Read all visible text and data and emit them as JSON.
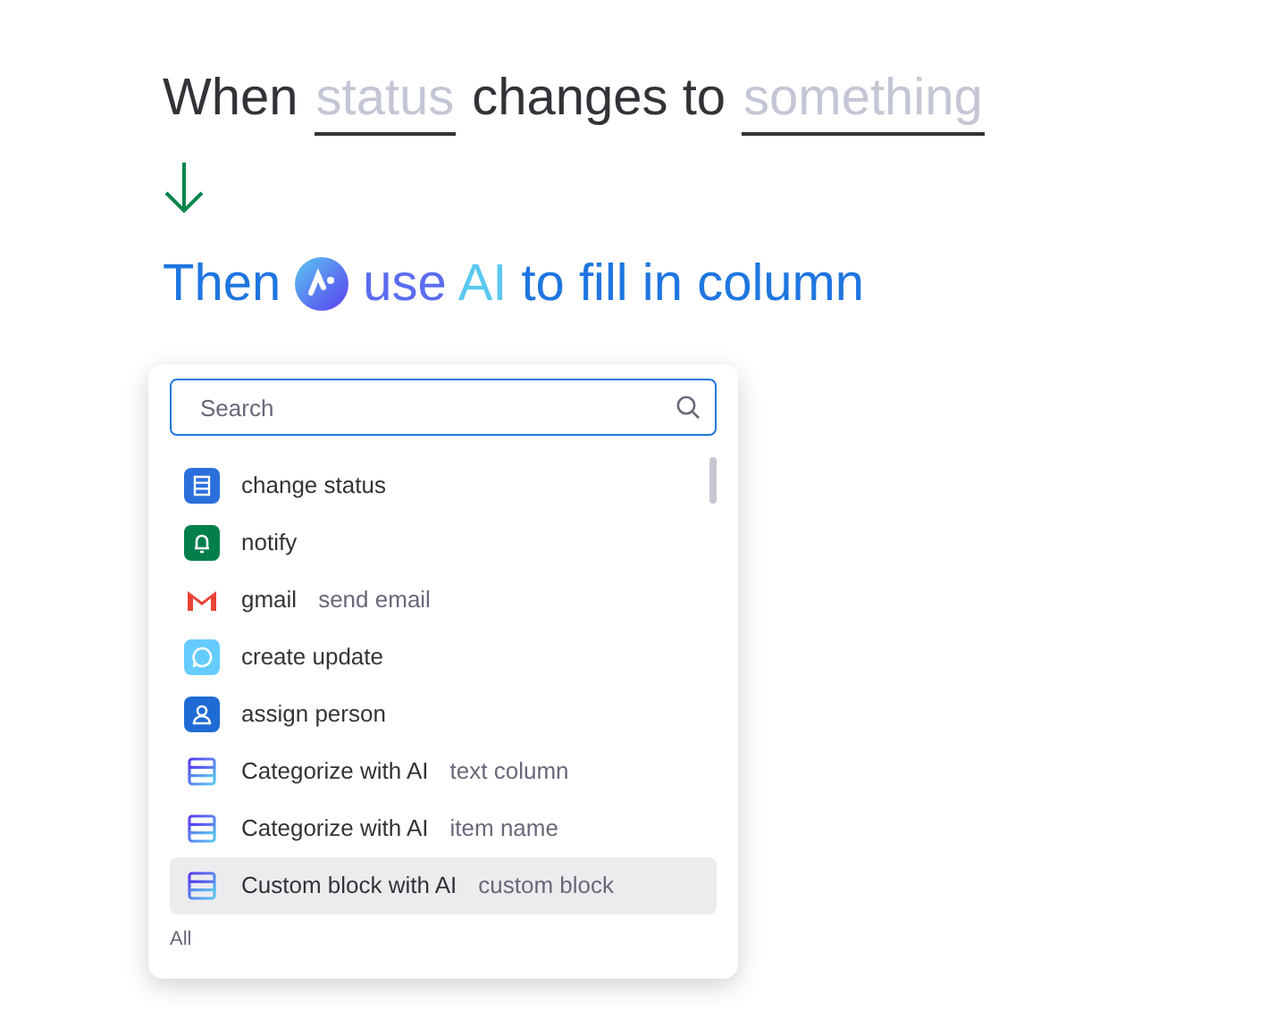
{
  "trigger": {
    "prefix": "When",
    "field": "status",
    "middle": "changes to",
    "value": "something"
  },
  "action": {
    "prefix": "Then",
    "highlight_1": "use",
    "highlight_2": "AI",
    "suffix": "to fill in column"
  },
  "dropdown": {
    "search": {
      "placeholder": "Search"
    },
    "items": [
      {
        "kind": "status",
        "label": "change status",
        "selected": false
      },
      {
        "kind": "notify",
        "label": "notify",
        "selected": false
      },
      {
        "kind": "gmail",
        "label": "gmail",
        "detail": "send email",
        "selected": false
      },
      {
        "kind": "update",
        "label": "create update",
        "selected": false
      },
      {
        "kind": "person",
        "label": "assign person",
        "selected": false
      },
      {
        "kind": "ai",
        "label": "Categorize with AI",
        "detail": "text column",
        "selected": false
      },
      {
        "kind": "ai",
        "label": "Categorize with AI",
        "detail": "item name",
        "selected": false
      },
      {
        "kind": "ai",
        "label": "Custom block with AI",
        "detail": "custom block",
        "selected": true
      }
    ],
    "section": "All"
  }
}
